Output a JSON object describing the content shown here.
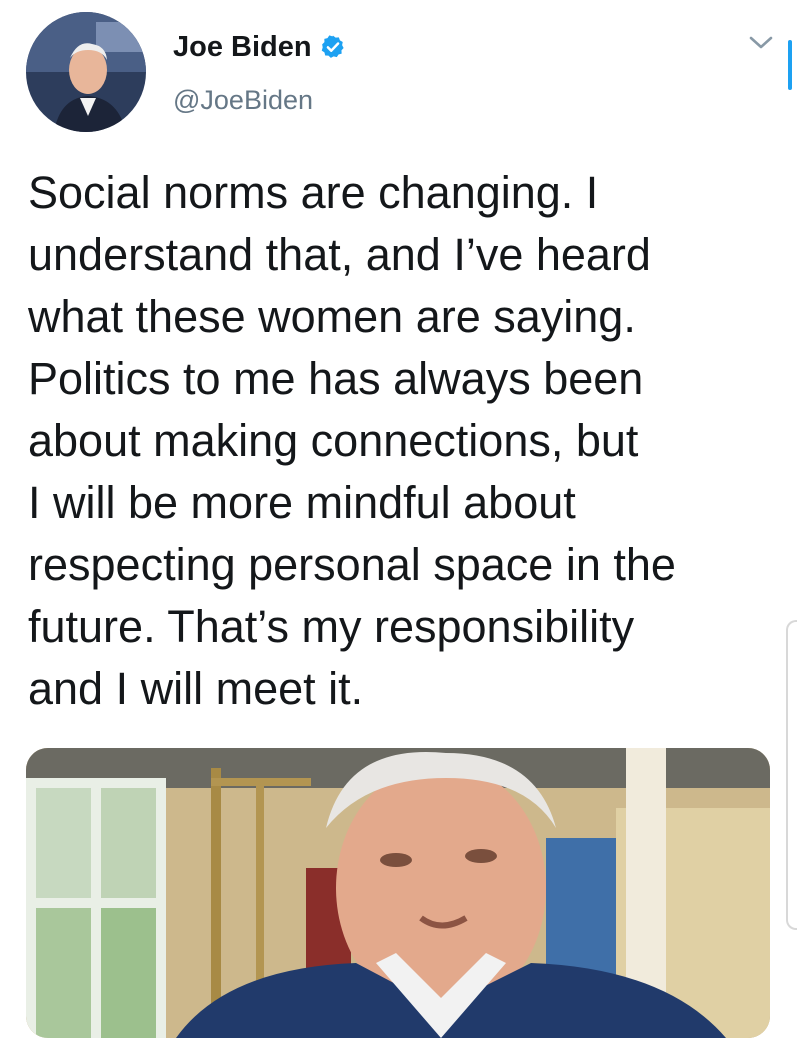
{
  "author": {
    "display_name": "Joe Biden",
    "handle": "@JoeBiden",
    "verified": true,
    "avatar_icon": "profile-photo"
  },
  "tweet": {
    "text": "Social norms are changing. I\nunderstand that, and I’ve heard\nwhat these women are saying.\nPolitics to me has always been\nabout making connections, but\nI will be more mindful about\nrespecting personal space in the\nfuture. That’s my responsibility\nand I will meet it."
  },
  "icons": {
    "menu": "chevron-down-icon",
    "verified": "verified-badge-icon"
  },
  "colors": {
    "accent": "#1da1f2",
    "text": "#14171a",
    "secondary_text": "#657786"
  }
}
